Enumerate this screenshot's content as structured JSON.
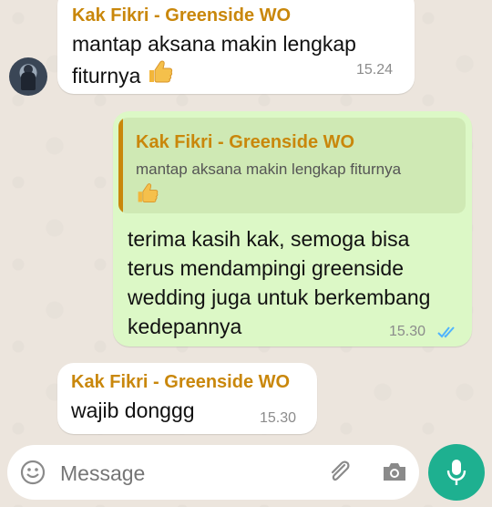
{
  "messages": [
    {
      "sender": "Kak Fikri - Greenside WO",
      "text_line1": "mantap aksana makin lengkap",
      "text_line2": "fiturnya",
      "emoji": "thumbs-up",
      "time": "15.24"
    },
    {
      "quote": {
        "sender": "Kak Fikri - Greenside WO",
        "text": "mantap aksana makin lengkap fiturnya",
        "emoji": "thumbs-up"
      },
      "lines": [
        "terima kasih kak, semoga bisa",
        "terus mendampingi greenside",
        "wedding juga untuk berkembang",
        "kedepannya"
      ],
      "time": "15.30",
      "status": "read"
    },
    {
      "sender": "Kak Fikri - Greenside WO",
      "text": "wajib donggg",
      "time": "15.30"
    }
  ],
  "composer": {
    "placeholder": "Message",
    "icons": [
      "emoji-icon",
      "paperclip-icon",
      "camera-icon",
      "microphone-icon"
    ]
  },
  "colors": {
    "sender": "#c9870b",
    "outgoing": "#dcf8c6",
    "incoming": "#ffffff",
    "read_ticks": "#4fb3ff",
    "mic_button": "#1eb090"
  }
}
